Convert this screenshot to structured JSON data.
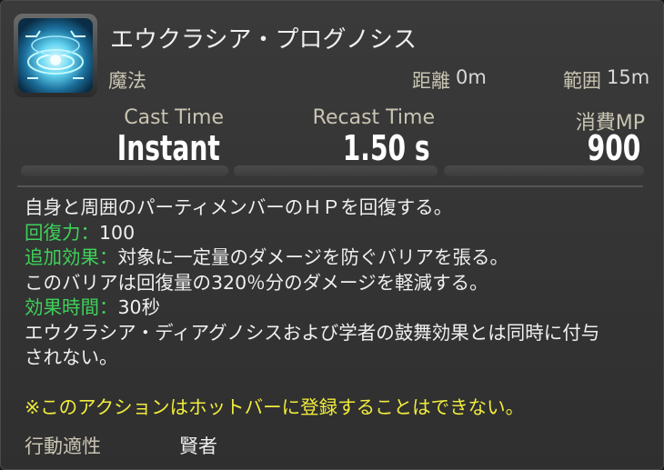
{
  "action": {
    "name": "エウクラシア・プログノシス",
    "category": "魔法",
    "icon": "eukrasian-prognosis-icon",
    "distance_label": "距離",
    "distance_value": "0m",
    "radius_label": "範囲",
    "radius_value": "15m"
  },
  "stats": {
    "cast_label": "Cast Time",
    "cast_value": "Instant",
    "recast_label": "Recast Time",
    "recast_value": "1.50 s",
    "cost_label": "消費MP",
    "cost_value": "900"
  },
  "description": {
    "line1": "自身と周囲のパーティメンバーのＨＰを回復する。",
    "potency_label": "回復力：",
    "potency_value": "100",
    "effect_label": "追加効果：",
    "effect_text": "対象に一定量のダメージを防ぐバリアを張る。",
    "line4": "このバリアは回復量の320％分のダメージを軽減する。",
    "duration_label": "効果時間：",
    "duration_value": "30秒",
    "line6": "エウクラシア・ディアグノシスおよび学者の鼓舞効果とは同時に付与",
    "line7": "されない。",
    "note": "※このアクションはホットバーに登録することはできない。"
  },
  "footer": {
    "label": "行動適性",
    "value": "賢者"
  },
  "colors": {
    "background": "#333333",
    "label": "#c9c4b2",
    "green": "#3fd15b",
    "note": "#f1ec3c"
  }
}
